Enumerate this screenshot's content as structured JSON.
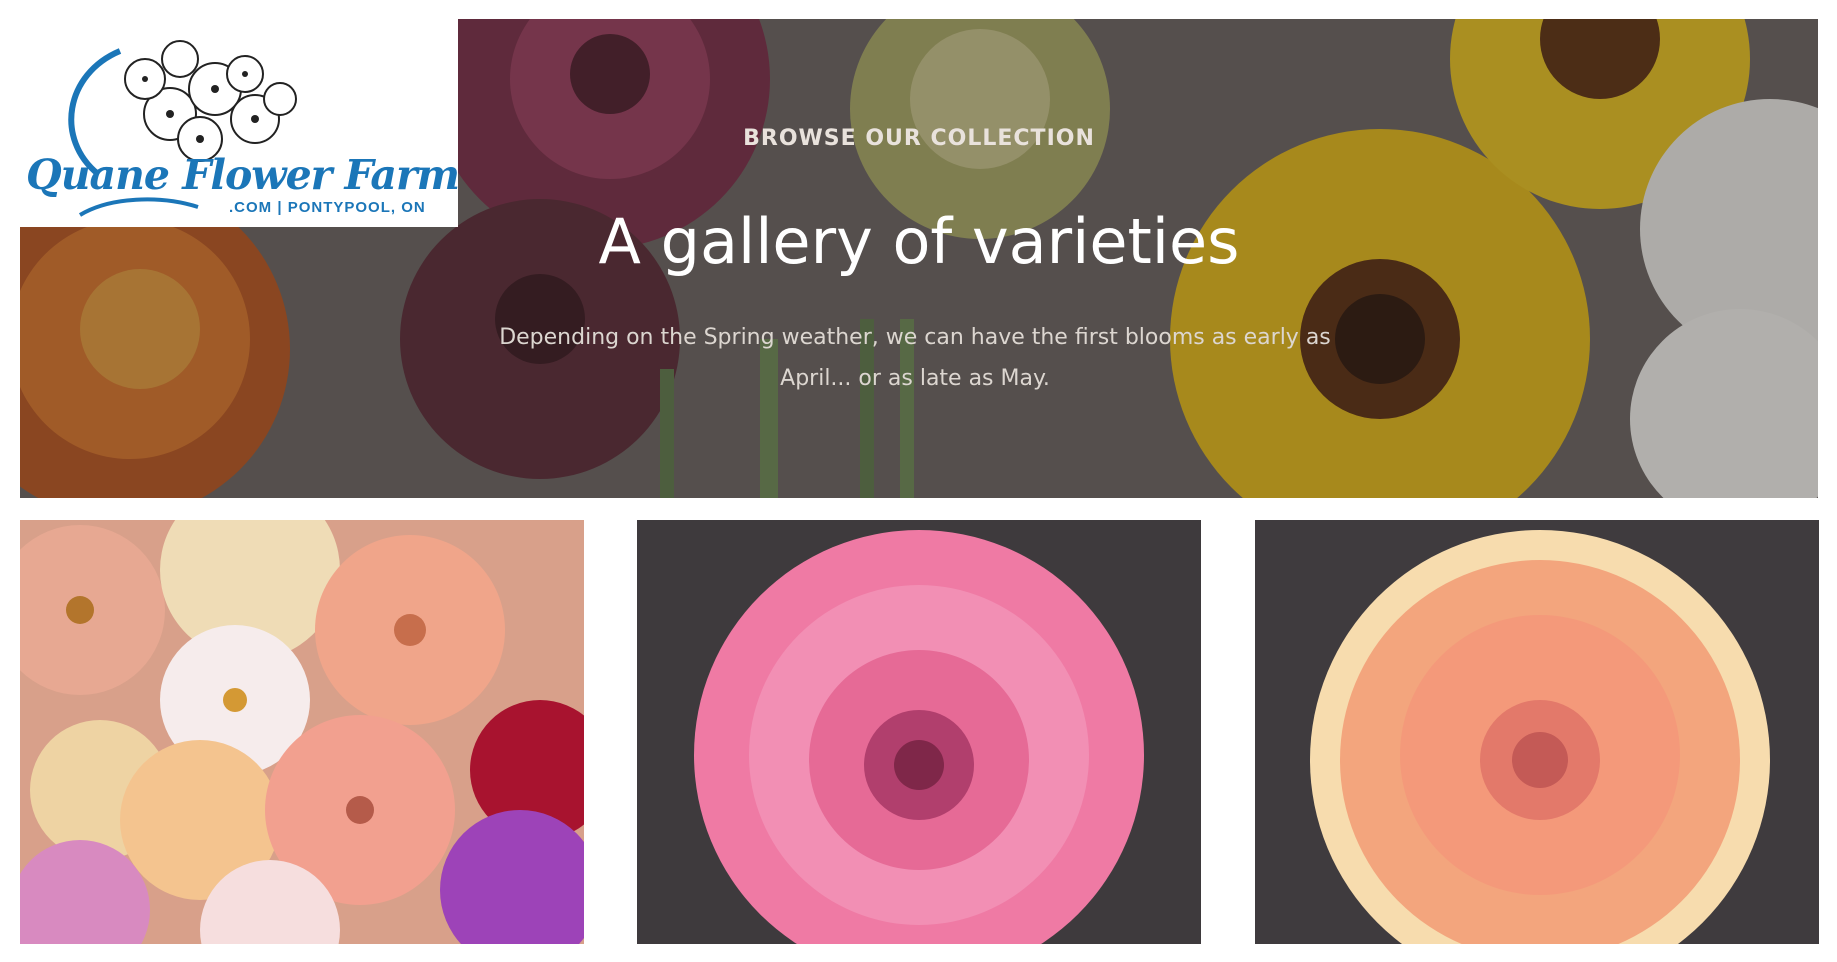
{
  "logo": {
    "name": "Quane Flower Farm",
    "sub": ".COM | PONTYPOOL, ON",
    "brand_color": "#1b76b8"
  },
  "hero": {
    "eyebrow": "BROWSE OUR COLLECTION",
    "title": "A gallery of varieties",
    "description": "Depending on the Spring weather, we can have the first blooms as early as April... or as late as May."
  },
  "gallery": [
    {
      "subject": "mixed dahlias"
    },
    {
      "subject": "pink dahlia"
    },
    {
      "subject": "peach dahlia"
    }
  ]
}
